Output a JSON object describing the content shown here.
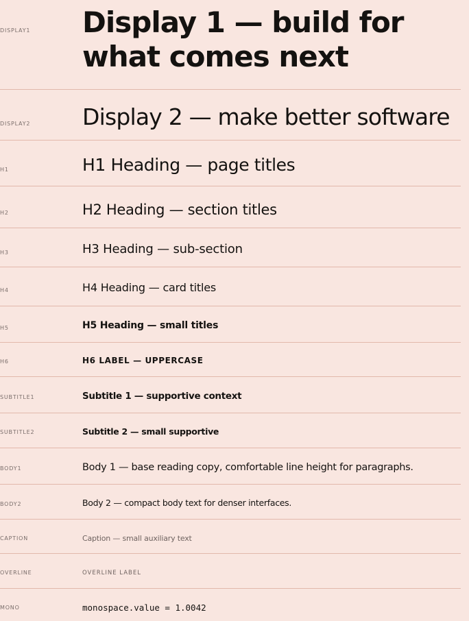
{
  "rows": [
    {
      "token": "DISPLAY1",
      "sample": "Display 1 — build for what comes next"
    },
    {
      "token": "DISPLAY2",
      "sample": "Display 2 — make better software"
    },
    {
      "token": "H1",
      "sample": "H1 Heading — page titles"
    },
    {
      "token": "H2",
      "sample": "H2 Heading — section titles"
    },
    {
      "token": "H3",
      "sample": "H3 Heading — sub-section"
    },
    {
      "token": "H4",
      "sample": "H4 Heading — card titles"
    },
    {
      "token": "H5",
      "sample": "H5 Heading — small titles"
    },
    {
      "token": "H6",
      "sample": "H6 LABEL — UPPERCASE"
    },
    {
      "token": "SUBTITLE1",
      "sample": "Subtitle 1 — supportive context"
    },
    {
      "token": "SUBTITLE2",
      "sample": "Subtitle 2 — small supportive"
    },
    {
      "token": "BODY1",
      "sample": "Body 1 — base reading copy, comfortable line height for paragraphs."
    },
    {
      "token": "BODY2",
      "sample": "Body 2 — compact body text for denser interfaces."
    },
    {
      "token": "CAPTION",
      "sample": "Caption — small auxiliary text"
    },
    {
      "token": "OVERLINE",
      "sample": "OVERLINE LABEL"
    },
    {
      "token": "MONO",
      "sample": "monospace.value = 1.0042"
    }
  ]
}
